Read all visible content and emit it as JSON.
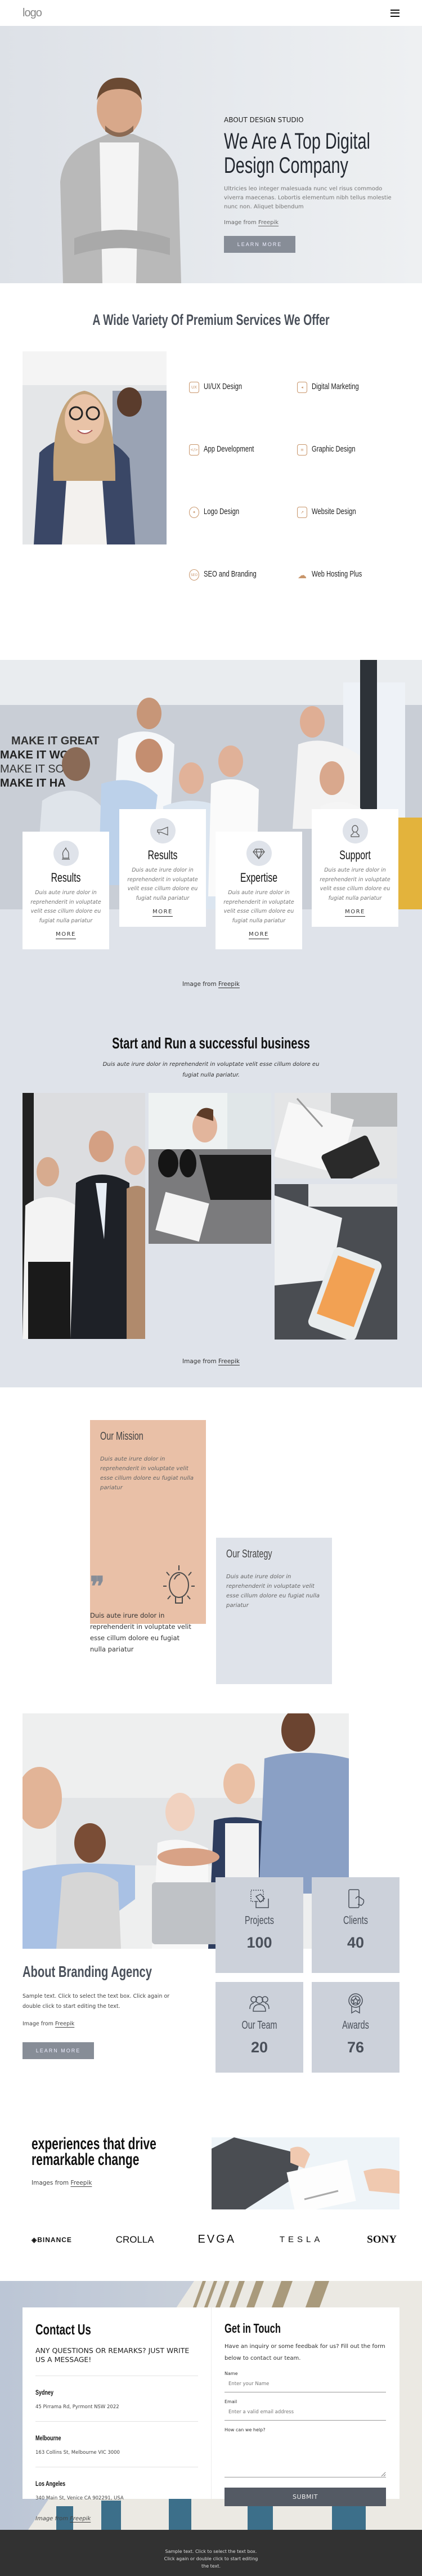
{
  "header": {
    "logo": "logo",
    "menu_icon": "hamburger-icon"
  },
  "hero": {
    "eyebrow": "ABOUT DESIGN STUDIO",
    "title": "We Are A Top Digital Design Company",
    "description": "Ultricies leo integer malesuada nunc vel risus commodo viverra maecenas. Lobortis elementum nibh tellus molestie nunc non. Aliquet bibendum",
    "credit_prefix": "Image from ",
    "credit_link": "Freepik",
    "button": "LEARN MORE"
  },
  "services": {
    "title": "A Wide Variety Of Premium Services We Offer",
    "items": [
      {
        "label": "UI/UX Design",
        "icon": "ux-icon",
        "glyph": "UX"
      },
      {
        "label": "Digital Marketing",
        "icon": "megaphone-icon",
        "glyph": "📣"
      },
      {
        "label": "App Development",
        "icon": "mobile-code-icon",
        "glyph": "</>"
      },
      {
        "label": "Graphic Design",
        "icon": "document-pen-icon",
        "glyph": "≡"
      },
      {
        "label": "Logo Design",
        "icon": "lightbulb-icon",
        "glyph": "✦"
      },
      {
        "label": "Website Design",
        "icon": "monitor-chart-icon",
        "glyph": "↗"
      },
      {
        "label": "SEO and Branding",
        "icon": "seo-icon",
        "glyph": "SEO"
      },
      {
        "label": "Web Hosting Plus",
        "icon": "cloud-network-icon",
        "glyph": "☁"
      }
    ]
  },
  "team": {
    "cards": [
      {
        "title": "Results",
        "icon": "chess-knight-icon",
        "glyph": "♘",
        "text": "Duis aute irure dolor in reprehenderit in voluptate velit esse cillum dolore eu fugiat nulla pariatur",
        "more": "MORE"
      },
      {
        "title": "Results",
        "icon": "megaphone-icon",
        "glyph": "📢",
        "text": "Duis aute irure dolor in reprehenderit in voluptate velit esse cillum dolore eu fugiat nulla pariatur",
        "more": "MORE"
      },
      {
        "title": "Expertise",
        "icon": "diamond-icon",
        "glyph": "◇",
        "text": "Duis aute irure dolor in reprehenderit in voluptate velit esse cillum dolore eu fugiat nulla pariatur",
        "more": "MORE"
      },
      {
        "title": "Support",
        "icon": "user-icon",
        "glyph": "👤",
        "text": "Duis aute irure dolor in reprehenderit in voluptate velit esse cillum dolore eu fugiat nulla pariatur",
        "more": "MORE"
      }
    ],
    "credit_prefix": "Image from ",
    "credit_link": "Freepik"
  },
  "business": {
    "title": "Start and Run a successful business",
    "description": "Duis aute irure dolor in reprehenderit in voluptate velit esse cillum dolore eu fugiat nulla pariatur.",
    "credit_prefix": "Image from ",
    "credit_link": "Freepik"
  },
  "mission": {
    "mission_title": "Our Mission",
    "mission_text": "Duis aute irure dolor in reprehenderit in voluptate velit esse cillum dolore eu fugiat nulla pariatur",
    "strategy_title": "Our Strategy",
    "strategy_text": "Duis aute irure dolor in reprehenderit in voluptate velit esse cillum dolore eu fugiat nulla pariatur",
    "quote": "Duis aute irure dolor in reprehenderit in voluptate velit esse cillum dolore eu fugiat nulla pariatur",
    "colors": {
      "mission_bg": "#e9c0a7",
      "strategy_bg": "#dfe3ea"
    }
  },
  "agency": {
    "title": "About Branding Agency",
    "description": "Sample text. Click to select the text box. Click again or double click to start editing the text.",
    "credit_prefix": "Image from ",
    "credit_link": "Freepik",
    "button": "LEARN MORE",
    "stats": [
      {
        "label": "Projects",
        "value": "100",
        "icon": "selection-edit-icon"
      },
      {
        "label": "Clients",
        "value": "40",
        "icon": "touch-phone-icon"
      },
      {
        "label": "Our Team",
        "value": "20",
        "icon": "team-icon"
      },
      {
        "label": "Awards",
        "value": "76",
        "icon": "award-icon"
      }
    ]
  },
  "partners": {
    "title": "experiences that drive remarkable change",
    "credit_prefix": "Images from ",
    "credit_link": "Freepik",
    "logos": [
      "BINANCE",
      "CROLLA",
      "EVGA",
      "TESLA",
      "SONY"
    ]
  },
  "contact": {
    "title": "Contact Us",
    "subtitle": "ANY QUESTIONS OR REMARKS? JUST WRITE US A MESSAGE!",
    "offices": [
      {
        "city": "Sydney",
        "address": "45 Pirrama Rd, Pyrmont NSW 2022"
      },
      {
        "city": "Melbourne",
        "address": "163 Collins St, Melbourne VIC 3000"
      },
      {
        "city": "Los Angeles",
        "address": "340 Main St, Venice CA 902291, USA"
      }
    ],
    "credit_prefix": "Image from ",
    "credit_link": "Freepik",
    "form": {
      "title": "Get in Touch",
      "subtitle": "Have an inquiry or some feedbak for us? Fill out the form below to contact our team.",
      "name_label": "Name",
      "name_placeholder": "Enter your Name",
      "email_label": "Email",
      "email_placeholder": "Enter a valid email address",
      "message_label": "How can we help?",
      "message_value": "",
      "submit": "SUBMIT"
    }
  },
  "footer": {
    "text": "Sample text. Click to select the text box. Click again or double click to start editing the text."
  }
}
